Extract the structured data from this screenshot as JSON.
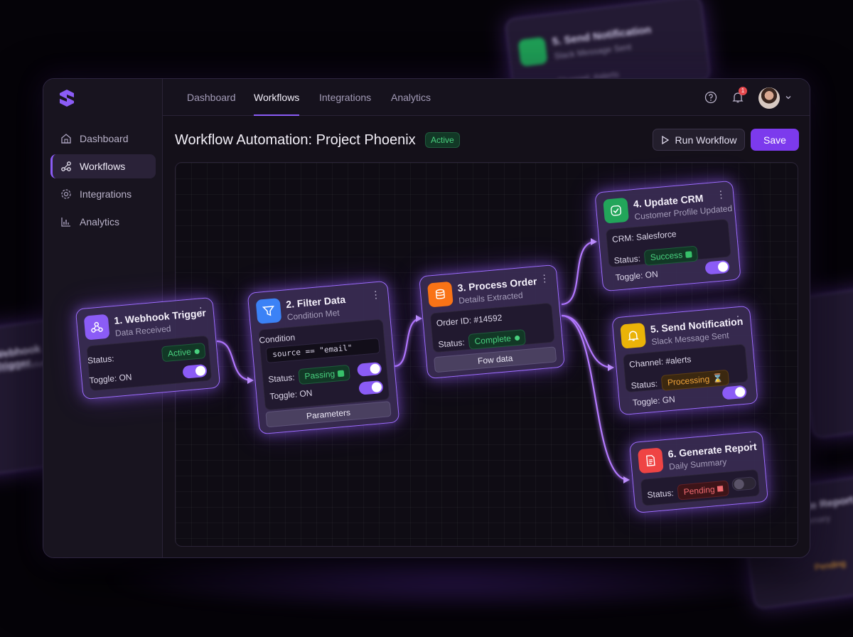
{
  "app": {
    "name": "Workflow Automation"
  },
  "topnav": {
    "tabs": [
      "Dashboard",
      "Workflows",
      "Integrations",
      "Analytics"
    ],
    "active": "Workflows",
    "notification_count": "1"
  },
  "sidebar": {
    "items": [
      {
        "label": "Dashboard",
        "icon": "home-icon"
      },
      {
        "label": "Workflows",
        "icon": "workflow-icon"
      },
      {
        "label": "Integrations",
        "icon": "gear-icon"
      },
      {
        "label": "Analytics",
        "icon": "chart-icon"
      }
    ],
    "active": "Workflows"
  },
  "header": {
    "title": "Workflow Automation: Project Phoenix",
    "status": "Active",
    "run_label": "Run Workflow",
    "save_label": "Save"
  },
  "colors": {
    "accent": "#8b5cf6",
    "success": "#49d17f",
    "warning": "#f2a43a",
    "danger": "#f06a70",
    "background": "#141019"
  },
  "nodes": {
    "n1": {
      "title": "1. Webhook Trigger",
      "subtitle": "Data Received",
      "status_label": "Status:",
      "status": "Active",
      "toggle_label": "Toggle: ON",
      "toggle": true
    },
    "n2": {
      "title": "2. Filter Data",
      "subtitle": "Condition Met",
      "condition_label": "Condition",
      "condition": "source == \"email\"",
      "status_label": "Status:",
      "status": "Passing",
      "toggle_label": "Toggle: ON",
      "toggle": true,
      "button": "Parameters"
    },
    "n3": {
      "title": "3. Process Order",
      "subtitle": "Details Extracted",
      "order": "Order ID: #14592",
      "status_label": "Status:",
      "status": "Complete",
      "button": "Fow data"
    },
    "n4": {
      "title": "4. Update CRM",
      "subtitle": "Customer Profile Updated",
      "crm": "CRM: Salesforce",
      "status_label": "Status:",
      "status": "Success",
      "toggle_label": "Toggle: ON",
      "toggle": true
    },
    "n5": {
      "title": "5. Send Notification",
      "subtitle": "Slack Message Sent",
      "channel": "Channel: #alerts",
      "status_label": "Status:",
      "status": "Processing",
      "toggle_label": "Toggle: GN",
      "toggle": true
    },
    "n6": {
      "title": "6. Generate Report",
      "subtitle": "Daily Summary",
      "status_label": "Status:",
      "status": "Pending",
      "toggle": false
    }
  },
  "ghosts": {
    "g1": {
      "title": "5. Send Notification",
      "subtitle": "Slack Message Sent",
      "row": "Channel: #alerts"
    },
    "g2": {
      "title": "Webhook Trigger",
      "subtitle": "Data Received"
    },
    "g3": {
      "title": "Generate Report",
      "subtitle": "Daily Summary",
      "status": "Pending"
    }
  }
}
